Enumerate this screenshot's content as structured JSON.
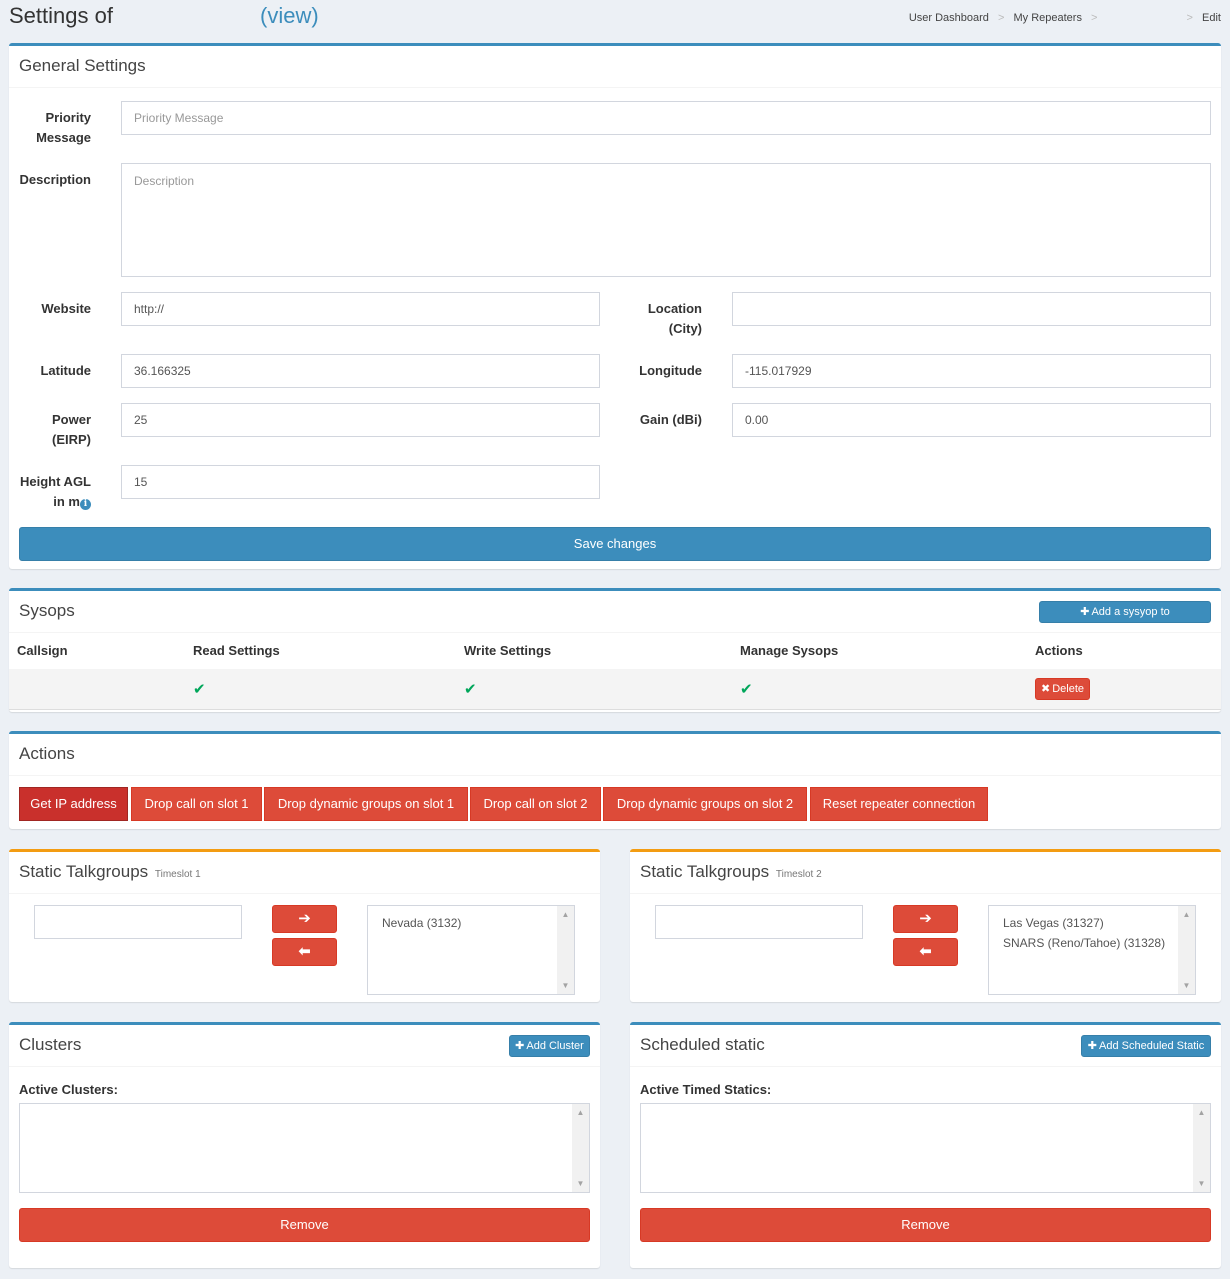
{
  "header": {
    "title": "Settings of",
    "view_link": "(view)",
    "breadcrumb": [
      "User Dashboard",
      "My Repeaters",
      "Edit"
    ],
    "breadcrumb_sep": ">"
  },
  "general": {
    "title": "General Settings",
    "priority_label": "Priority Message",
    "priority_placeholder": "Priority Message",
    "description_label": "Description",
    "description_placeholder": "Description",
    "website_label": "Website",
    "website_value": "http://",
    "location_label": "Location (City)",
    "location_value": "",
    "latitude_label": "Latitude",
    "latitude_value": "36.166325",
    "longitude_label": "Longitude",
    "longitude_value": "-115.017929",
    "power_label": "Power (EIRP)",
    "power_value": "25",
    "gain_label": "Gain (dBi)",
    "gain_value": "0.00",
    "height_label": "Height AGL in m",
    "height_value": "15",
    "save_label": "Save changes"
  },
  "sysops": {
    "title": "Sysops",
    "add_label": "Add a sysyop to",
    "columns": [
      "Callsign",
      "Read Settings",
      "Write Settings",
      "Manage Sysops",
      "Actions"
    ],
    "rows": [
      {
        "callsign": "",
        "read": "✔",
        "write": "✔",
        "manage": "✔",
        "delete_label": "Delete"
      }
    ]
  },
  "actions": {
    "title": "Actions",
    "buttons": [
      "Get IP address",
      "Drop call on slot 1",
      "Drop dynamic groups on slot 1",
      "Drop call on slot 2",
      "Drop dynamic groups on slot 2",
      "Reset repeater connection"
    ]
  },
  "static_ts1": {
    "title": "Static Talkgroups",
    "subtitle": "Timeslot 1",
    "input_value": "",
    "items": [
      "Nevada (3132)"
    ]
  },
  "static_ts2": {
    "title": "Static Talkgroups",
    "subtitle": "Timeslot 2",
    "input_value": "",
    "items": [
      "Las Vegas (31327)",
      "SNARS (Reno/Tahoe) (31328)"
    ]
  },
  "clusters": {
    "title": "Clusters",
    "add_label": "Add Cluster",
    "active_label": "Active Clusters:",
    "remove_label": "Remove"
  },
  "scheduled": {
    "title": "Scheduled static",
    "add_label": "Add Scheduled Static",
    "active_label": "Active Timed Statics:",
    "remove_label": "Remove"
  },
  "colors": {
    "primary": "#3c8dbc",
    "danger": "#dd4b39",
    "warning": "#f39c12",
    "success": "#00a65a",
    "background": "#ecf0f5"
  }
}
